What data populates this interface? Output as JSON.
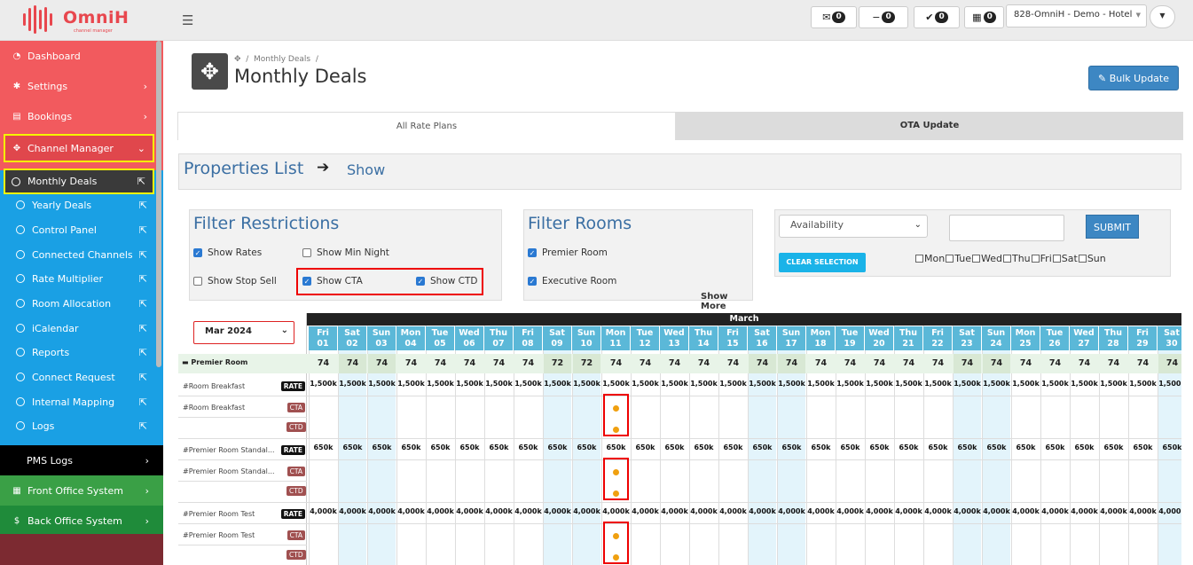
{
  "brand": {
    "name": "OmniH",
    "tagline": "channel manager"
  },
  "topbar": {
    "counters": [
      {
        "icon": "envelope-icon",
        "glyph": "✉",
        "count": "0"
      },
      {
        "icon": "minus-icon",
        "glyph": "−",
        "count": "0"
      },
      {
        "icon": "check-icon",
        "glyph": "✔",
        "count": "0"
      },
      {
        "icon": "calendar-icon",
        "glyph": "▦",
        "count": "0"
      }
    ],
    "property": "828-OmniH - Demo - Hotel"
  },
  "sidebar": {
    "items": [
      {
        "label": "Dashboard",
        "icon": "dashboard-icon",
        "glyph": "◔",
        "chev": ""
      },
      {
        "label": "Settings",
        "icon": "gear-icon",
        "glyph": "✱",
        "chev": "›"
      },
      {
        "label": "Bookings",
        "icon": "keyboard-icon",
        "glyph": "▤",
        "chev": "›"
      },
      {
        "label": "Channel Manager",
        "icon": "arrows-icon",
        "glyph": "✥",
        "chev": "⌄"
      }
    ],
    "subitems": [
      "Monthly Deals",
      "Yearly Deals",
      "Control Panel",
      "Connected Channels",
      "Rate Multiplier",
      "Room Allocation",
      "iCalendar",
      "Reports",
      "Connect Request",
      "Internal Mapping",
      "Logs"
    ],
    "bottom": [
      {
        "label": "PMS Logs",
        "chev": "›",
        "bg": "#000000"
      },
      {
        "label": "Front Office System",
        "glyph": "▦",
        "chev": "›",
        "bg": "#3aa046"
      },
      {
        "label": "Back Office System",
        "glyph": "$",
        "chev": "›",
        "bg": "#1f8b3a"
      }
    ]
  },
  "page": {
    "breadcrumb": "Monthly Deals",
    "title": "Monthly Deals",
    "bulk_update": "Bulk Update"
  },
  "tabs": [
    "All Rate Plans",
    "OTA Update"
  ],
  "properties": {
    "title": "Properties List",
    "show": "Show"
  },
  "filter_restrictions": {
    "title": "Filter Restrictions",
    "options": [
      {
        "label": "Show Rates",
        "checked": true
      },
      {
        "label": "Show Min Night",
        "checked": false
      },
      {
        "label": "Show Stop Sell",
        "checked": false
      },
      {
        "label": "Show CTA",
        "checked": true
      },
      {
        "label": "Show CTD",
        "checked": true
      }
    ]
  },
  "filter_rooms": {
    "title": "Filter Rooms",
    "options": [
      {
        "label": "Premier Room",
        "checked": true
      },
      {
        "label": "Executive Room",
        "checked": true
      }
    ],
    "show_more": "Show More"
  },
  "bulk": {
    "select": "Availability",
    "submit": "SUBMIT",
    "clear": "CLEAR SELECTION",
    "days": [
      "Mon",
      "Tue",
      "Wed",
      "Thu",
      "Fri",
      "Sat",
      "Sun"
    ]
  },
  "calendar": {
    "month_select": "Mar 2024",
    "month": "March",
    "days": [
      {
        "d": "Fri",
        "n": "01"
      },
      {
        "d": "Sat",
        "n": "02"
      },
      {
        "d": "Sun",
        "n": "03"
      },
      {
        "d": "Mon",
        "n": "04"
      },
      {
        "d": "Tue",
        "n": "05"
      },
      {
        "d": "Wed",
        "n": "06"
      },
      {
        "d": "Thu",
        "n": "07"
      },
      {
        "d": "Fri",
        "n": "08"
      },
      {
        "d": "Sat",
        "n": "09"
      },
      {
        "d": "Sun",
        "n": "10"
      },
      {
        "d": "Mon",
        "n": "11"
      },
      {
        "d": "Tue",
        "n": "12"
      },
      {
        "d": "Wed",
        "n": "13"
      },
      {
        "d": "Thu",
        "n": "14"
      },
      {
        "d": "Fri",
        "n": "15"
      },
      {
        "d": "Sat",
        "n": "16"
      },
      {
        "d": "Sun",
        "n": "17"
      },
      {
        "d": "Mon",
        "n": "18"
      },
      {
        "d": "Tue",
        "n": "19"
      },
      {
        "d": "Wed",
        "n": "20"
      },
      {
        "d": "Thu",
        "n": "21"
      },
      {
        "d": "Fri",
        "n": "22"
      },
      {
        "d": "Sat",
        "n": "23"
      },
      {
        "d": "Sun",
        "n": "24"
      },
      {
        "d": "Mon",
        "n": "25"
      },
      {
        "d": "Tue",
        "n": "26"
      },
      {
        "d": "Wed",
        "n": "27"
      },
      {
        "d": "Thu",
        "n": "28"
      },
      {
        "d": "Fri",
        "n": "29"
      },
      {
        "d": "Sat",
        "n": "30"
      }
    ],
    "room": "Premier Room",
    "availability": [
      "74",
      "74",
      "74",
      "74",
      "74",
      "74",
      "74",
      "74",
      "72",
      "72",
      "74",
      "74",
      "74",
      "74",
      "74",
      "74",
      "74",
      "74",
      "74",
      "74",
      "74",
      "74",
      "74",
      "74",
      "74",
      "74",
      "74",
      "74",
      "74",
      "74"
    ],
    "plans": [
      {
        "name": "Room Breakfast",
        "rate": "1,500k",
        "cta_name": "Room Breakfast"
      },
      {
        "name": "Premier Room Standal...",
        "rate": "650k",
        "cta_name": "Premier Room Standal..."
      },
      {
        "name": "Premier Room Test",
        "rate": "4,000k",
        "cta_name": "Premier Room Test"
      }
    ],
    "badges": {
      "rate": "RATE",
      "cta": "CTA",
      "ctd": "CTD"
    },
    "marked_day_index": 10
  }
}
